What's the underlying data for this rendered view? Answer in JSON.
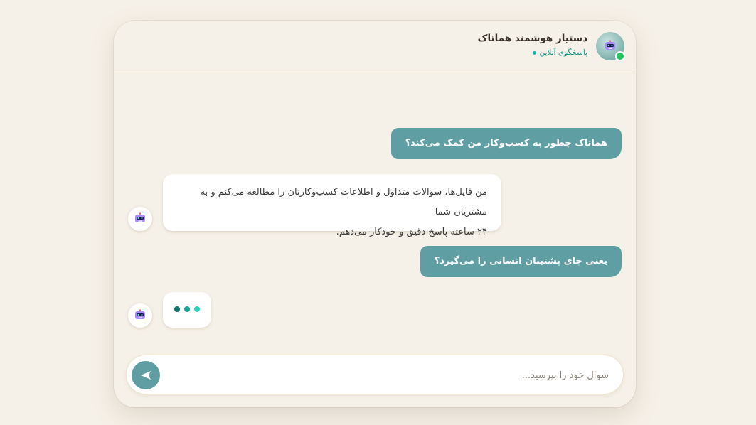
{
  "header": {
    "title": "دستیار هوشمند هماتاک",
    "status": "پاسخگوی آنلاین",
    "avatar_icon": "robot-icon"
  },
  "messages": [
    {
      "sender": "user",
      "text": "هماتاک چطور به کسب‌وکار من کمک می‌کند؟"
    },
    {
      "sender": "bot",
      "lines": [
        "من فایل‌ها، سوالات متداول و اطلاعات کسب‌وکارتان را مطالعه می‌کنم و به مشتریان شما",
        "۲۴ ساعته پاسخ دقیق و خودکار می‌دهم."
      ]
    },
    {
      "sender": "user",
      "text": "یعنی جای پشتیبان انسانی را می‌گیرد؟"
    }
  ],
  "input": {
    "placeholder": "سوال خود را بپرسید...",
    "value": ""
  },
  "colors": {
    "background": "#f6f1e8",
    "accent": "#5f9ea3",
    "online": "#22c55e",
    "status_text": "#0f9488"
  }
}
